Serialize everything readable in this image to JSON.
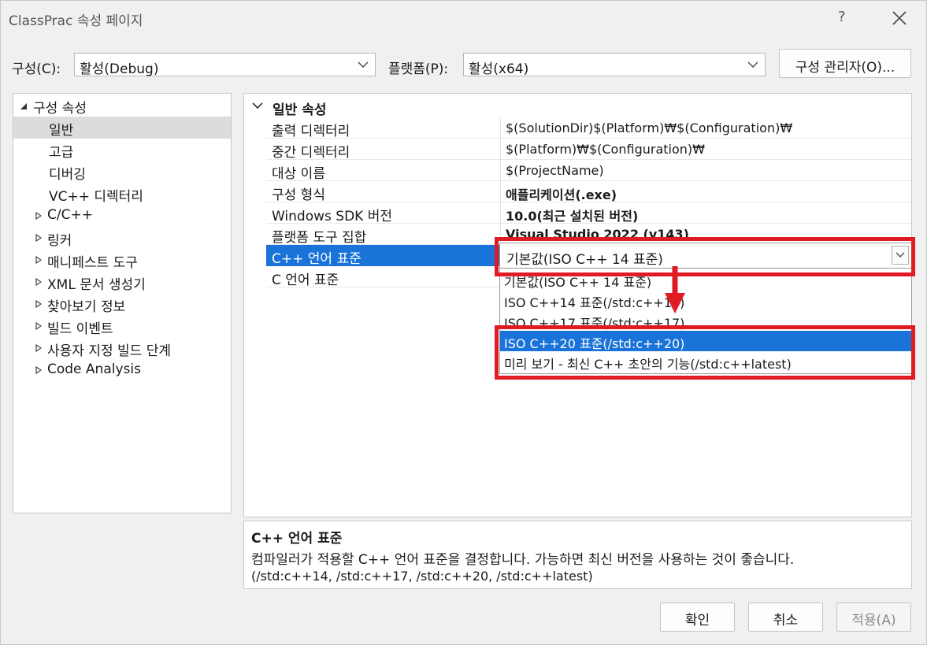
{
  "window": {
    "title": "ClassPrac 속성 페이지",
    "help": "?"
  },
  "toolbar": {
    "config_label": "구성(C):",
    "config_value": "활성(Debug)",
    "platform_label": "플랫폼(P):",
    "platform_value": "활성(x64)",
    "config_manager_label": "구성 관리자(O)..."
  },
  "tree": {
    "root": "구성 속성",
    "items": [
      {
        "label": "일반",
        "expandable": false,
        "selected": true
      },
      {
        "label": "고급",
        "expandable": false
      },
      {
        "label": "디버깅",
        "expandable": false
      },
      {
        "label": "VC++ 디렉터리",
        "expandable": false
      },
      {
        "label": "C/C++",
        "expandable": true
      },
      {
        "label": "링커",
        "expandable": true
      },
      {
        "label": "매니페스트 도구",
        "expandable": true
      },
      {
        "label": "XML 문서 생성기",
        "expandable": true
      },
      {
        "label": "찾아보기 정보",
        "expandable": true
      },
      {
        "label": "빌드 이벤트",
        "expandable": true
      },
      {
        "label": "사용자 지정 빌드 단계",
        "expandable": true
      },
      {
        "label": "Code Analysis",
        "expandable": true
      }
    ]
  },
  "grid": {
    "section": "일반 속성",
    "rows": [
      {
        "name": "출력 디렉터리",
        "value": "$(SolutionDir)$(Platform)₩$(Configuration)₩",
        "bold": false
      },
      {
        "name": "중간 디렉터리",
        "value": "$(Platform)₩$(Configuration)₩",
        "bold": false
      },
      {
        "name": "대상 이름",
        "value": "$(ProjectName)",
        "bold": false
      },
      {
        "name": "구성 형식",
        "value": "애플리케이션(.exe)",
        "bold": true
      },
      {
        "name": "Windows SDK 버전",
        "value": "10.0(최근 설치된 버전)",
        "bold": true
      },
      {
        "name": "플랫폼 도구 집합",
        "value": "Visual Studio 2022 (v143)",
        "bold": true
      },
      {
        "name": "C++ 언어 표준",
        "value": "기본값(ISO C++ 14 표준)",
        "bold": false,
        "selected": true
      },
      {
        "name": "C 언어 표준",
        "value": "",
        "bold": false
      }
    ]
  },
  "dropdown": {
    "current": "기본값(ISO C++ 14 표준)",
    "options": [
      {
        "label": "기본값(ISO C++ 14 표준)"
      },
      {
        "label": "ISO C++14 표준(/std:c++14)"
      },
      {
        "label": "ISO C++17 표준(/std:c++17)"
      },
      {
        "label": "ISO C++20 표준(/std:c++20)",
        "selected": true
      },
      {
        "label": "미리 보기 - 최신 C++ 초안의 기능(/std:c++latest)"
      }
    ]
  },
  "description": {
    "title": "C++ 언어 표준",
    "line1": "컴파일러가 적용할 C++ 언어 표준을 결정합니다. 가능하면 최신 버전을 사용하는 것이 좋습니다.",
    "line2": "(/std:c++14, /std:c++17, /std:c++20, /std:c++latest)"
  },
  "buttons": {
    "ok": "확인",
    "cancel": "취소",
    "apply": "적용(A)"
  },
  "colors": {
    "selection": "#1a73d9",
    "annotation": "#e01b24",
    "tree_selection": "#dcdcdc"
  }
}
